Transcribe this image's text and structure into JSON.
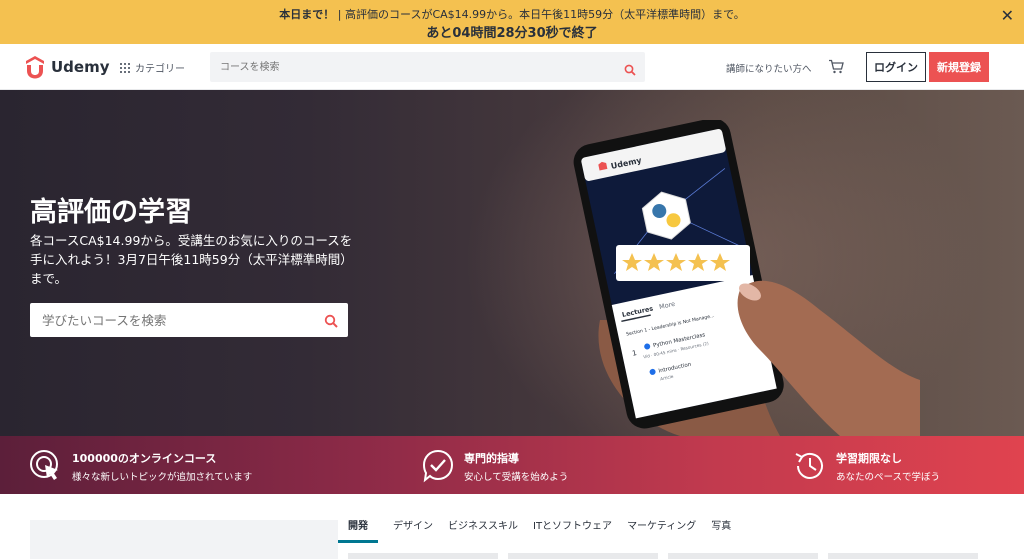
{
  "promo": {
    "line1_bold": "本日まで！",
    "line1_rest": " | 高評価のコースがCA$14.99から。本日午後11時59分（太平洋標準時間）まで。",
    "line2": "あと04時間28分30秒で終了",
    "close_glyph": "✕"
  },
  "header": {
    "logo_text": "Udemy",
    "categories_label": "カテゴリー",
    "search_placeholder": "コースを検索",
    "teach_link": "講師になりたい方へ",
    "login_label": "ログイン",
    "signup_label": "新規登録",
    "accent_color": "#ec5252"
  },
  "hero": {
    "title": "高評価の学習",
    "subtitle": "各コースCA$14.99から。受講生のお気に入りのコースを手に入れよう！3月7日午後11時59分（太平洋標準時間）まで。",
    "search_placeholder": "学びたいコースを検索",
    "phone": {
      "brand": "Udemy",
      "tab_lectures": "Lectures",
      "tab_more": "More",
      "section": "Section 1 - Leadership is Not Manage...",
      "item1_num": "1",
      "item1_title": "Python Masterclass",
      "item1_meta": "Vid · 00:45 mins · Resources (2)",
      "item2_title": "Introduction",
      "item2_meta": "Article",
      "rating_stars": 5
    }
  },
  "features": [
    {
      "icon": "target-cursor-icon",
      "title": "100000のオンラインコース",
      "subtitle": "様々な新しいトピックが追加されています"
    },
    {
      "icon": "check-badge-icon",
      "title": "専門的指導",
      "subtitle": "安心して受講を始めよう"
    },
    {
      "icon": "history-clock-icon",
      "title": "学習期限なし",
      "subtitle": "あなたのペースで学ぼう"
    }
  ],
  "tabs": [
    "開発",
    "デザイン",
    "ビジネススキル",
    "ITとソフトウェア",
    "マーケティング",
    "写真"
  ]
}
